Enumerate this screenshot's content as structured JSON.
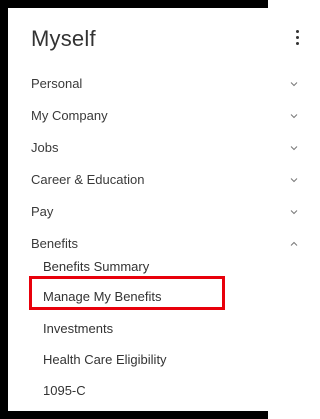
{
  "panel": {
    "title": "Myself",
    "more_icon": "kebab-menu-icon"
  },
  "nav": {
    "items": [
      {
        "label": "Personal",
        "expanded": false
      },
      {
        "label": "My Company",
        "expanded": false
      },
      {
        "label": "Jobs",
        "expanded": false
      },
      {
        "label": "Career & Education",
        "expanded": false
      },
      {
        "label": "Pay",
        "expanded": false
      },
      {
        "label": "Benefits",
        "expanded": true
      }
    ],
    "benefits_sub": [
      {
        "label": "Benefits Summary"
      },
      {
        "label": "Manage My Benefits",
        "highlighted": true
      },
      {
        "label": "Investments"
      },
      {
        "label": "Health Care Eligibility"
      },
      {
        "label": "1095-C"
      }
    ]
  },
  "colors": {
    "frame": "#000000",
    "highlight": "#e8000b",
    "text": "#333333"
  }
}
